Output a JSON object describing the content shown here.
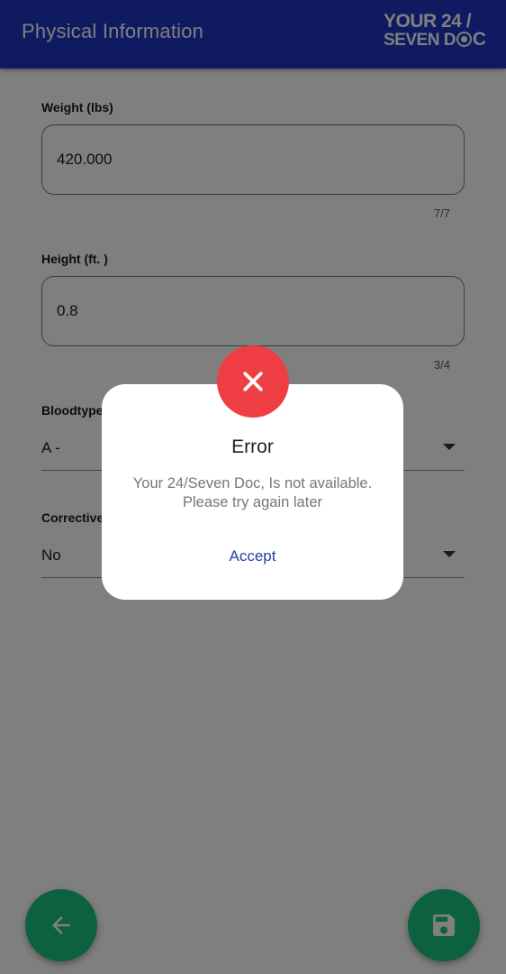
{
  "header": {
    "title": "Physical Information",
    "logo": {
      "line1": "YOUR 24 /",
      "line2_prefix": "SEVEN D",
      "line2_suffix": "C"
    }
  },
  "form": {
    "weight": {
      "label": "Weight (lbs)",
      "value": "420.000",
      "counter": "7/7"
    },
    "height": {
      "label": "Height (ft. )",
      "value": "0.8",
      "counter": "3/4"
    },
    "bloodtype": {
      "label": "Bloodtype",
      "value": "A -"
    },
    "corrective": {
      "label": "Corrective",
      "value": "No"
    }
  },
  "buttons": {
    "back_icon": "arrow-left-icon",
    "save_icon": "save-icon"
  },
  "dialog": {
    "icon": "close-icon",
    "title": "Error",
    "message": "Your 24/Seven Doc, Is not available. Please try again later",
    "accept_label": "Accept"
  },
  "colors": {
    "header": "#1f35c2",
    "fab": "#19c37d",
    "error": "#ee3e43",
    "accent_link": "#2341a8"
  }
}
